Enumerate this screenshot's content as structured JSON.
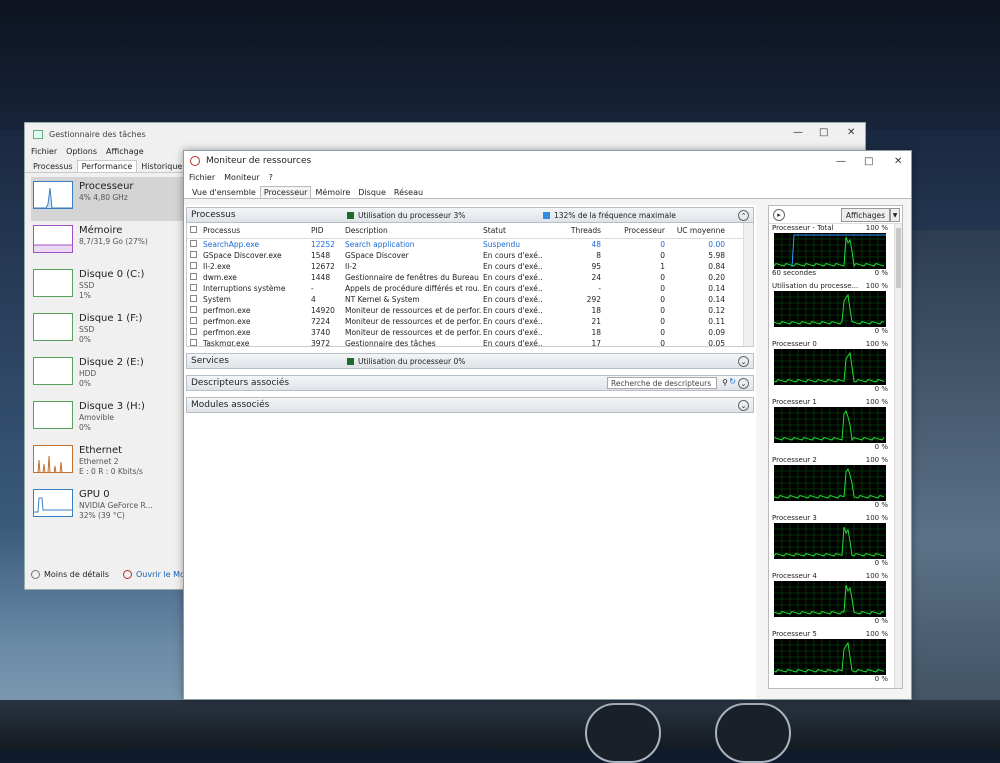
{
  "task_manager": {
    "title": "Gestionnaire des tâches",
    "menu": [
      "Fichier",
      "Options",
      "Affichage"
    ],
    "tabs": [
      "Processus",
      "Performance",
      "Historique des ap"
    ],
    "side_items": [
      {
        "name": "Processeur",
        "sub1": "4% 4,80 GHz",
        "sub2": ""
      },
      {
        "name": "Mémoire",
        "sub1": "8,7/31,9 Go (27%)",
        "sub2": ""
      },
      {
        "name": "Disque 0 (C:)",
        "sub1": "SSD",
        "sub2": "1%"
      },
      {
        "name": "Disque 1 (F:)",
        "sub1": "SSD",
        "sub2": "0%"
      },
      {
        "name": "Disque 2 (E:)",
        "sub1": "HDD",
        "sub2": "0%"
      },
      {
        "name": "Disque 3 (H:)",
        "sub1": "Amovible",
        "sub2": "0%"
      },
      {
        "name": "Ethernet",
        "sub1": "Ethernet 2",
        "sub2": "E : 0 R : 0 Kbits/s"
      },
      {
        "name": "GPU 0",
        "sub1": "NVIDIA GeForce R...",
        "sub2": "32% (39 °C)"
      }
    ],
    "footer_less": "Moins de détails",
    "footer_open": "Ouvrir le Monit"
  },
  "resource_monitor": {
    "title": "Moniteur de ressources",
    "menu": [
      "Fichier",
      "Moniteur",
      "?"
    ],
    "tabs": [
      "Vue d'ensemble",
      "Processeur",
      "Mémoire",
      "Disque",
      "Réseau"
    ],
    "processes_section": {
      "title": "Processus",
      "cpu_usage": "Utilisation du processeur 3%",
      "max_freq": "132% de la fréquence maximale",
      "columns": [
        "Processus",
        "PID",
        "Description",
        "Statut",
        "Threads",
        "Processeur",
        "UC moyenne"
      ],
      "rows": [
        [
          "SearchApp.exe",
          "12252",
          "Search application",
          "Suspendu",
          "48",
          "0",
          "0.00"
        ],
        [
          "GSpace Discover.exe",
          "1548",
          "GSpace Discover",
          "En cours d'exé...",
          "8",
          "0",
          "5.98"
        ],
        [
          "Il-2.exe",
          "12672",
          "Il-2",
          "En cours d'exé...",
          "95",
          "1",
          "0.84"
        ],
        [
          "dwm.exe",
          "1448",
          "Gestionnaire de fenêtres du Bureau",
          "En cours d'exé...",
          "24",
          "0",
          "0.20"
        ],
        [
          "Interruptions système",
          "-",
          "Appels de procédure différés et rou...",
          "En cours d'exé...",
          "-",
          "0",
          "0.14"
        ],
        [
          "System",
          "4",
          "NT Kernel & System",
          "En cours d'exé...",
          "292",
          "0",
          "0.14"
        ],
        [
          "perfmon.exe",
          "14920",
          "Moniteur de ressources et de perfor...",
          "En cours d'exé...",
          "18",
          "0",
          "0.12"
        ],
        [
          "perfmon.exe",
          "7224",
          "Moniteur de ressources et de perfor...",
          "En cours d'exé...",
          "21",
          "0",
          "0.11"
        ],
        [
          "perfmon.exe",
          "3740",
          "Moniteur de ressources et de perfor...",
          "En cours d'exé...",
          "18",
          "0",
          "0.09"
        ],
        [
          "Taskmgr.exe",
          "3972",
          "Gestionnaire des tâches",
          "En cours d'exé...",
          "17",
          "0",
          "0.05"
        ]
      ]
    },
    "services_section": {
      "title": "Services",
      "cpu_usage": "Utilisation du processeur 0%"
    },
    "handles_section": {
      "title": "Descripteurs associés",
      "search_placeholder": "Recherche de descripteurs"
    },
    "modules_section": {
      "title": "Modules associés"
    },
    "views_button": "Affichages",
    "graphs": [
      {
        "name": "Processeur - Total",
        "max": "100 %",
        "foot_left": "60 secondes",
        "foot_right": "0 %"
      },
      {
        "name": "Utilisation du processe...",
        "max": "100 %",
        "foot_left": "",
        "foot_right": "0 %"
      },
      {
        "name": "Processeur 0",
        "max": "100 %",
        "foot_left": "",
        "foot_right": "0 %"
      },
      {
        "name": "Processeur 1",
        "max": "100 %",
        "foot_left": "",
        "foot_right": "0 %"
      },
      {
        "name": "Processeur 2",
        "max": "100 %",
        "foot_left": "",
        "foot_right": "0 %"
      },
      {
        "name": "Processeur 3",
        "max": "100 %",
        "foot_left": "",
        "foot_right": "0 %"
      },
      {
        "name": "Processeur 4",
        "max": "100 %",
        "foot_left": "",
        "foot_right": "0 %"
      },
      {
        "name": "Processeur 5",
        "max": "100 %",
        "foot_left": "",
        "foot_right": "0 %"
      }
    ]
  },
  "colors": {
    "cpu_usage": "#1f6b2a",
    "max_freq": "#2f8ee0",
    "graph_green": "#22dd33",
    "graph_blue": "#3399ff"
  }
}
